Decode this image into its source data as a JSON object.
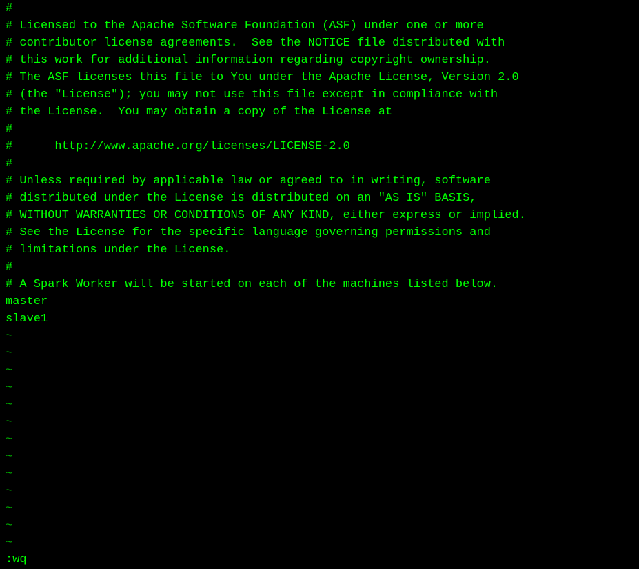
{
  "editor": {
    "lines": [
      "#",
      "# Licensed to the Apache Software Foundation (ASF) under one or more",
      "# contributor license agreements.  See the NOTICE file distributed with",
      "# this work for additional information regarding copyright ownership.",
      "# The ASF licenses this file to You under the Apache License, Version 2.0",
      "# (the \"License\"); you may not use this file except in compliance with",
      "# the License.  You may obtain a copy of the License at",
      "#",
      "#      http://www.apache.org/licenses/LICENSE-2.0",
      "#",
      "# Unless required by applicable law or agreed to in writing, software",
      "# distributed under the License is distributed on an \"AS IS\" BASIS,",
      "# WITHOUT WARRANTIES OR CONDITIONS OF ANY KIND, either express or implied.",
      "# See the License for the specific language governing permissions and",
      "# limitations under the License.",
      "#",
      "",
      "# A Spark Worker will be started on each of the machines listed below.",
      "master",
      "slave1"
    ],
    "tilde_lines": 14,
    "status": ":wq"
  }
}
